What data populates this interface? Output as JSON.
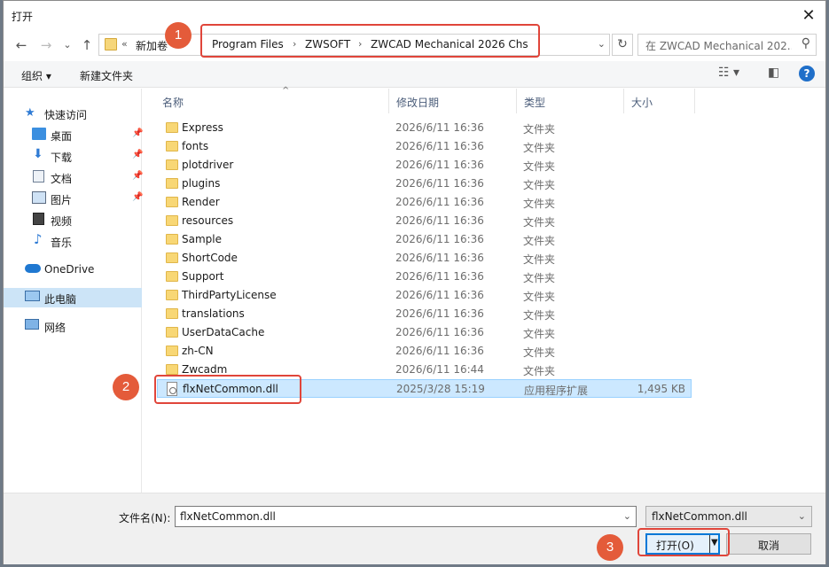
{
  "window": {
    "title": "打开",
    "close_glyph": "✕"
  },
  "nav": {
    "back_glyph": "←",
    "forward_glyph": "→",
    "dropdown_glyph": "⌄",
    "up_glyph": "↑",
    "address": {
      "overflow": "«",
      "crumbs": [
        "新加卷",
        "Program Files",
        "ZWSOFT",
        "ZWCAD Mechanical 2026 Chs"
      ],
      "separator": "›",
      "chevron": "⌄"
    },
    "refresh_glyph": "↻",
    "search_placeholder": "在 ZWCAD Mechanical 202...",
    "search_glyph": "⚲"
  },
  "toolbar": {
    "organize": "组织 ▾",
    "new_folder": "新建文件夹",
    "view_glyph": "☷ ▾",
    "pane_glyph": "◧",
    "help_glyph": "?"
  },
  "sidebar": {
    "pin_glyph": "📌",
    "items": [
      {
        "label": "快速访问",
        "icon": "star-icon"
      },
      {
        "label": "桌面",
        "icon": "desktop-icon",
        "pinned": true
      },
      {
        "label": "下载",
        "icon": "download-icon",
        "pinned": true
      },
      {
        "label": "文档",
        "icon": "document-icon",
        "pinned": true
      },
      {
        "label": "图片",
        "icon": "picture-icon",
        "pinned": true
      },
      {
        "label": "视频",
        "icon": "video-icon"
      },
      {
        "label": "音乐",
        "icon": "music-icon"
      },
      {
        "label": "OneDrive",
        "icon": "cloud-icon"
      },
      {
        "label": "此电脑",
        "icon": "computer-icon",
        "selected": true
      },
      {
        "label": "网络",
        "icon": "network-icon"
      }
    ]
  },
  "columns": {
    "name": "名称",
    "date": "修改日期",
    "type": "类型",
    "size": "大小",
    "sort_caret": "^"
  },
  "files": [
    {
      "name": "Express",
      "date": "2026/6/11 16:36",
      "type": "文件夹",
      "size": "",
      "kind": "folder"
    },
    {
      "name": "fonts",
      "date": "2026/6/11 16:36",
      "type": "文件夹",
      "size": "",
      "kind": "folder"
    },
    {
      "name": "plotdriver",
      "date": "2026/6/11 16:36",
      "type": "文件夹",
      "size": "",
      "kind": "folder"
    },
    {
      "name": "plugins",
      "date": "2026/6/11 16:36",
      "type": "文件夹",
      "size": "",
      "kind": "folder"
    },
    {
      "name": "Render",
      "date": "2026/6/11 16:36",
      "type": "文件夹",
      "size": "",
      "kind": "folder"
    },
    {
      "name": "resources",
      "date": "2026/6/11 16:36",
      "type": "文件夹",
      "size": "",
      "kind": "folder"
    },
    {
      "name": "Sample",
      "date": "2026/6/11 16:36",
      "type": "文件夹",
      "size": "",
      "kind": "folder"
    },
    {
      "name": "ShortCode",
      "date": "2026/6/11 16:36",
      "type": "文件夹",
      "size": "",
      "kind": "folder"
    },
    {
      "name": "Support",
      "date": "2026/6/11 16:36",
      "type": "文件夹",
      "size": "",
      "kind": "folder"
    },
    {
      "name": "ThirdPartyLicense",
      "date": "2026/6/11 16:36",
      "type": "文件夹",
      "size": "",
      "kind": "folder"
    },
    {
      "name": "translations",
      "date": "2026/6/11 16:36",
      "type": "文件夹",
      "size": "",
      "kind": "folder"
    },
    {
      "name": "UserDataCache",
      "date": "2026/6/11 16:36",
      "type": "文件夹",
      "size": "",
      "kind": "folder"
    },
    {
      "name": "zh-CN",
      "date": "2026/6/11 16:36",
      "type": "文件夹",
      "size": "",
      "kind": "folder"
    },
    {
      "name": "Zwcadm",
      "date": "2026/6/11 16:44",
      "type": "文件夹",
      "size": "",
      "kind": "folder"
    },
    {
      "name": "flxNetCommon.dll",
      "date": "2025/3/28 15:19",
      "type": "应用程序扩展",
      "size": "1,495 KB",
      "kind": "dll",
      "selected": true
    }
  ],
  "footer": {
    "filename_label": "文件名(N):",
    "filename_value": "flxNetCommon.dll",
    "filename_chevron": "⌄",
    "filetype_value": "flxNetCommon.dll",
    "filetype_chevron": "⌄",
    "open_label": "打开(O)",
    "open_arrow": "▼",
    "cancel_label": "取消"
  },
  "annotations": [
    "1",
    "2",
    "3"
  ],
  "colors": {
    "accent": "#0078d7",
    "annotation": "#e45b3a",
    "selection": "#cce8ff"
  }
}
